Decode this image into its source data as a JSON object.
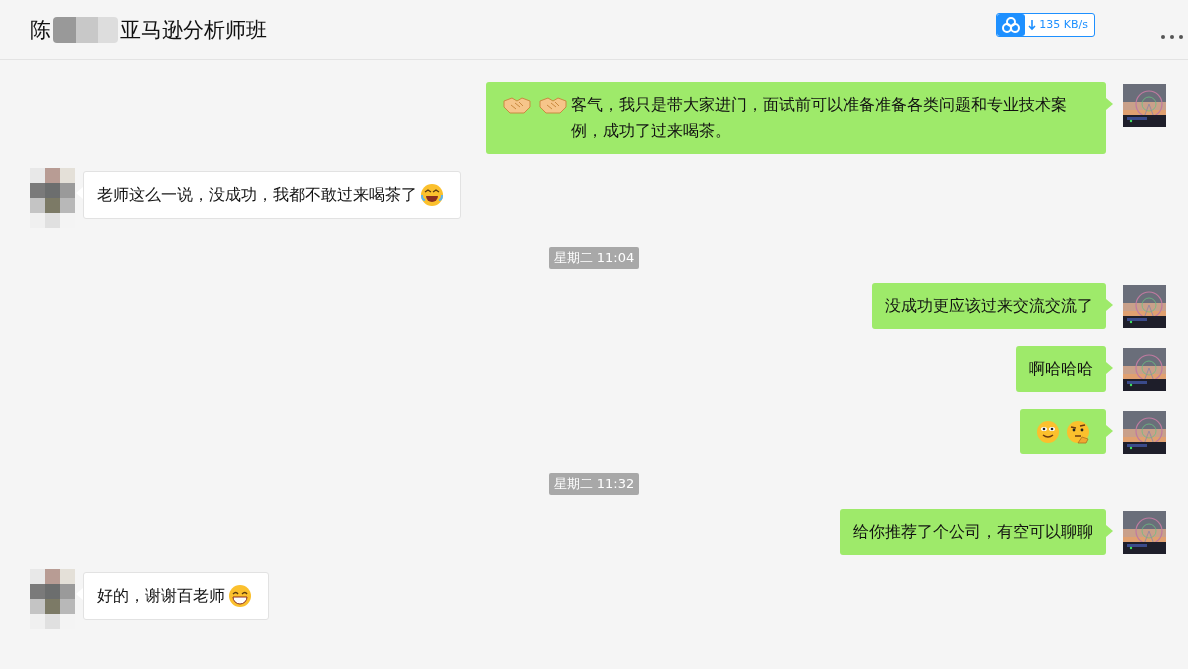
{
  "header": {
    "title_start": "陈",
    "title_end": "亚马逊分析师班",
    "speed": "135 KB/s"
  },
  "messages": [
    {
      "kind": "sent",
      "parts": [
        {
          "kind": "handshake"
        },
        {
          "kind": "handshake"
        },
        {
          "kind": "text",
          "text": "客气，我只是带大家进门，面试前可以准备准备各类问题和专业技术案例，成功了过来喝茶。"
        }
      ]
    },
    {
      "kind": "received",
      "parts": [
        {
          "kind": "text",
          "text": "老师这么一说，没成功，我都不敢过来喝茶了"
        },
        {
          "kind": "laugh"
        }
      ]
    },
    {
      "kind": "time",
      "text": "星期二 11:04"
    },
    {
      "kind": "sent",
      "parts": [
        {
          "kind": "text",
          "text": "没成功更应该过来交流交流了"
        }
      ]
    },
    {
      "kind": "sent",
      "parts": [
        {
          "kind": "text",
          "text": "啊哈哈哈"
        }
      ]
    },
    {
      "kind": "sent",
      "parts": [
        {
          "kind": "smile"
        },
        {
          "kind": "think"
        }
      ]
    },
    {
      "kind": "time",
      "text": "星期二 11:32"
    },
    {
      "kind": "sent",
      "parts": [
        {
          "kind": "text",
          "text": "给你推荐了个公司，有空可以聊聊"
        }
      ]
    },
    {
      "kind": "received",
      "parts": [
        {
          "kind": "text",
          "text": "好的，谢谢百老师"
        },
        {
          "kind": "grin"
        }
      ]
    }
  ]
}
